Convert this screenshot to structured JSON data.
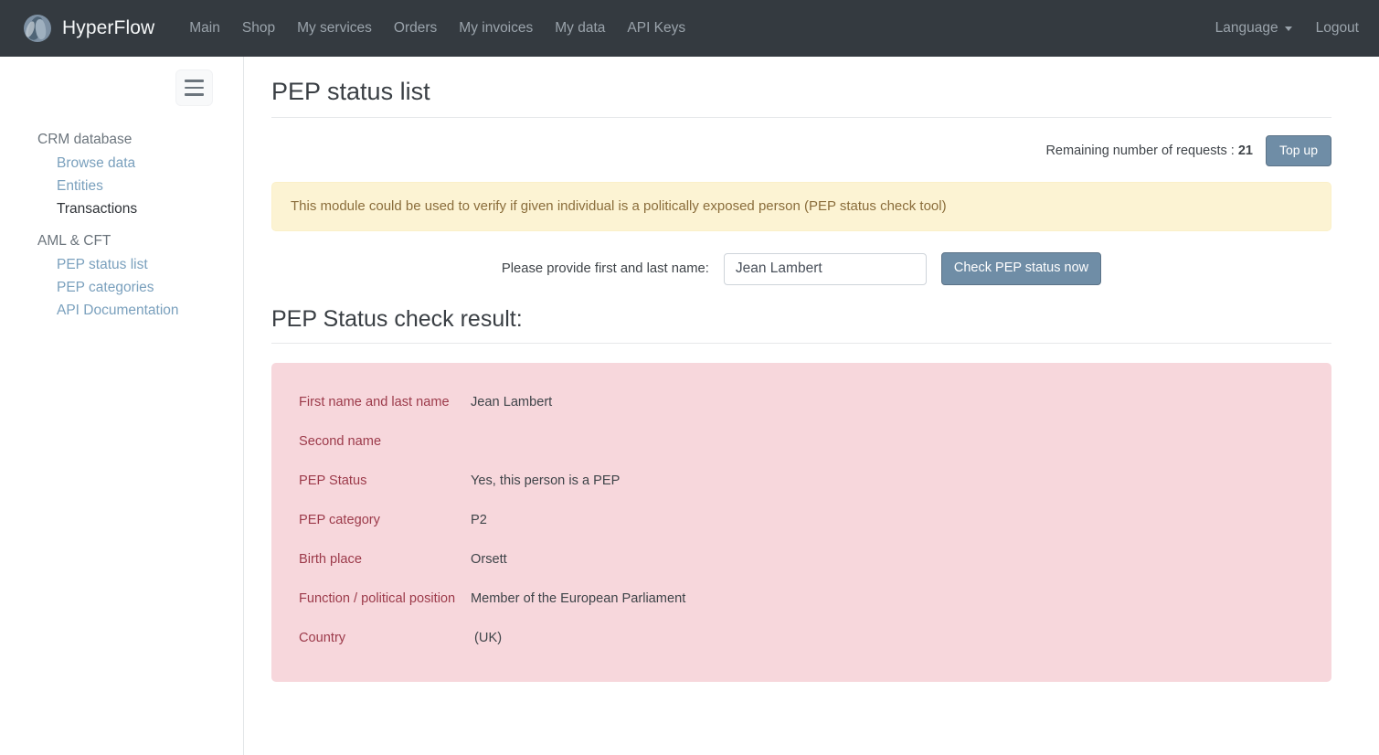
{
  "navbar": {
    "brand": "HyperFlow",
    "brand_icon": "flow-logo-icon",
    "links": [
      {
        "label": "Main"
      },
      {
        "label": "Shop"
      },
      {
        "label": "My services"
      },
      {
        "label": "Orders"
      },
      {
        "label": "My invoices"
      },
      {
        "label": "My data"
      },
      {
        "label": "API Keys"
      }
    ],
    "language_label": "Language",
    "logout_label": "Logout",
    "background_color": "#343a40",
    "link_color": "#9aa3ab"
  },
  "sidebar": {
    "toggle_icon": "hamburger-icon",
    "groups": [
      {
        "title": "CRM database",
        "items": [
          {
            "label": "Browse data",
            "active": false
          },
          {
            "label": "Entities",
            "active": false
          },
          {
            "label": "Transactions",
            "active": true
          }
        ]
      },
      {
        "title": "AML & CFT",
        "items": [
          {
            "label": "PEP status list",
            "active": false
          },
          {
            "label": "PEP categories",
            "active": false
          },
          {
            "label": "API Documentation",
            "active": false
          }
        ]
      }
    ],
    "link_color": "#7aa0bd",
    "active_color": "#2f3338"
  },
  "main": {
    "page_title": "PEP status list",
    "quota": {
      "text_prefix": "Remaining number of requests : ",
      "value": "21",
      "topup_label": "Top up",
      "button_color": "#6f8da6"
    },
    "alert": {
      "text": "This module could be used to verify if given individual is a politically exposed person (PEP status check tool)",
      "background_color": "#fcf3d3",
      "text_color": "#8a6d3b"
    },
    "form": {
      "label": "Please provide first and last name:",
      "input_value": "Jean Lambert",
      "input_placeholder": "",
      "submit_label": "Check PEP status now"
    },
    "result": {
      "title": "PEP Status check result:",
      "panel_color": "#f7d7dc",
      "label_color": "#9c3a4a",
      "rows": [
        {
          "label": "First name and last name",
          "value": "Jean Lambert"
        },
        {
          "label": "Second name",
          "value": ""
        },
        {
          "label": "PEP Status",
          "value": "Yes, this person is a PEP"
        },
        {
          "label": "PEP category",
          "value": "P2"
        },
        {
          "label": "Birth place",
          "value": "Orsett"
        },
        {
          "label": "Function / political position",
          "value": "Member of the European Parliament"
        },
        {
          "label": "Country",
          "value": " (UK)"
        }
      ]
    }
  }
}
